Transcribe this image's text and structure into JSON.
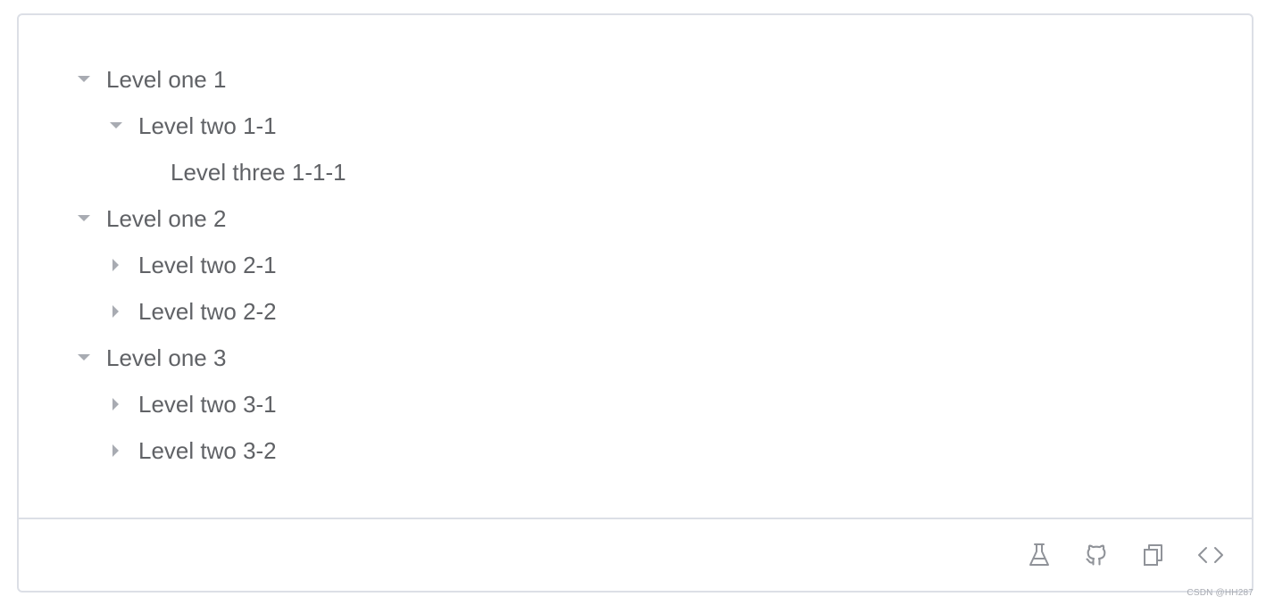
{
  "tree": {
    "nodes": [
      {
        "label": "Level one 1",
        "level": 1,
        "expander": "expanded"
      },
      {
        "label": "Level two 1-1",
        "level": 2,
        "expander": "expanded"
      },
      {
        "label": "Level three 1-1-1",
        "level": 3,
        "expander": "none"
      },
      {
        "label": "Level one 2",
        "level": 1,
        "expander": "expanded"
      },
      {
        "label": "Level two 2-1",
        "level": 2,
        "expander": "collapsed"
      },
      {
        "label": "Level two 2-2",
        "level": 2,
        "expander": "collapsed"
      },
      {
        "label": "Level one 3",
        "level": 1,
        "expander": "expanded"
      },
      {
        "label": "Level two 3-1",
        "level": 2,
        "expander": "collapsed"
      },
      {
        "label": "Level two 3-2",
        "level": 2,
        "expander": "collapsed"
      }
    ]
  },
  "footer": {
    "actions": [
      {
        "icon": "flask-icon",
        "name": "playground-button"
      },
      {
        "icon": "github-icon",
        "name": "github-button"
      },
      {
        "icon": "copy-icon",
        "name": "copy-button"
      },
      {
        "icon": "code-icon",
        "name": "view-source-button"
      }
    ]
  },
  "watermark": "CSDN @HH287",
  "colors": {
    "text": "#606266",
    "caret": "#a8abb2",
    "border": "#dcdfe6",
    "icon": "#909399"
  }
}
